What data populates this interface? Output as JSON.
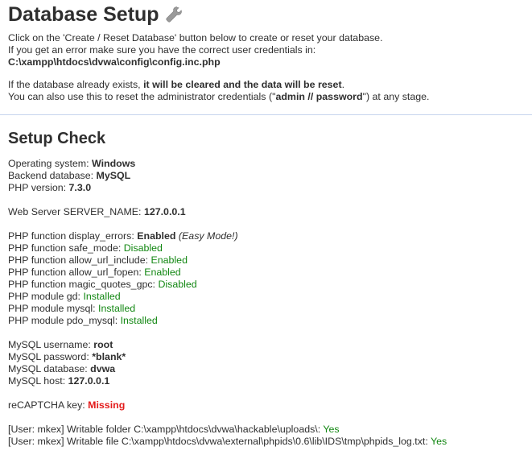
{
  "header": {
    "title": "Database Setup",
    "title_icon": "wrench-icon"
  },
  "intro": {
    "line1": "Click on the 'Create / Reset Database' button below to create or reset your database.",
    "line2": "If you get an error make sure you have the correct user credentials in:",
    "config_path": "C:\\xampp\\htdocs\\dvwa\\config\\config.inc.php",
    "line3_prefix": "If the database already exists, ",
    "line3_bold": "it will be cleared and the data will be reset",
    "line3_suffix": ".",
    "line4_prefix": "You can also use this to reset the administrator credentials (\"",
    "line4_bold": "admin // password",
    "line4_suffix": "\") at any stage."
  },
  "setup_check": {
    "title": "Setup Check",
    "os_label": "Operating system: ",
    "os_value": "Windows",
    "backend_label": "Backend database: ",
    "backend_value": "MySQL",
    "php_version_label": "PHP version: ",
    "php_version_value": "7.3.0",
    "server_name_label": "Web Server SERVER_NAME: ",
    "server_name_value": "127.0.0.1",
    "display_errors_label": "PHP function display_errors: ",
    "display_errors_value": "Enabled",
    "display_errors_note": "(Easy Mode!)",
    "safe_mode_label": "PHP function safe_mode: ",
    "safe_mode_value": "Disabled",
    "allow_url_include_label": "PHP function allow_url_include: ",
    "allow_url_include_value": "Enabled",
    "allow_url_fopen_label": "PHP function allow_url_fopen: ",
    "allow_url_fopen_value": "Enabled",
    "magic_quotes_label": "PHP function magic_quotes_gpc: ",
    "magic_quotes_value": "Disabled",
    "gd_label": "PHP module gd: ",
    "gd_value": "Installed",
    "mysql_module_label": "PHP module mysql: ",
    "mysql_module_value": "Installed",
    "pdo_mysql_label": "PHP module pdo_mysql: ",
    "pdo_mysql_value": "Installed",
    "mysql_username_label": "MySQL username: ",
    "mysql_username_value": "root",
    "mysql_password_label": "MySQL password: ",
    "mysql_password_value": "*blank*",
    "mysql_database_label": "MySQL database: ",
    "mysql_database_value": "dvwa",
    "mysql_host_label": "MySQL host: ",
    "mysql_host_value": "127.0.0.1",
    "recaptcha_label": "reCAPTCHA key: ",
    "recaptcha_value": "Missing",
    "writable_folder_label": "[User: mkex] Writable folder C:\\xampp\\htdocs\\dvwa\\hackable\\uploads\\: ",
    "writable_folder_value": "Yes",
    "writable_file_label": "[User: mkex] Writable file C:\\xampp\\htdocs\\dvwa\\external\\phpids\\0.6\\lib\\IDS\\tmp\\phpids_log.txt: ",
    "writable_file_value": "Yes"
  },
  "colors": {
    "ok": "#128712",
    "missing": "#e31b1b",
    "separator": "#c7d4ee",
    "text": "#2f2f2f"
  }
}
